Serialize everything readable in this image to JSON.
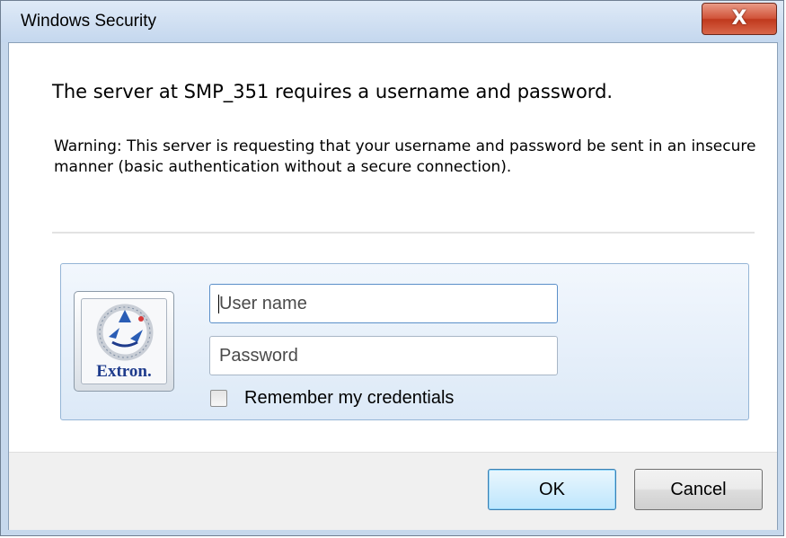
{
  "window": {
    "title": "Windows Security",
    "close_glyph": "X"
  },
  "message": {
    "heading": "The server at SMP_351 requires a username and password.",
    "warning": "Warning: This server is requesting that your username and password be sent in an insecure manner (basic authentication without a secure connection)."
  },
  "credentials": {
    "logo_text": "Extron.",
    "username_placeholder": "User name",
    "username_value": "",
    "password_placeholder": "Password",
    "password_value": "",
    "remember_label": "Remember my credentials",
    "remember_checked": false
  },
  "buttons": {
    "ok_label": "OK",
    "cancel_label": "Cancel"
  },
  "colors": {
    "accent": "#3c7fb1",
    "close_button": "#c0391d",
    "logo_blue": "#1e3b8c"
  },
  "icons": {
    "close": "close-icon",
    "logo": "extron-logo-icon"
  }
}
